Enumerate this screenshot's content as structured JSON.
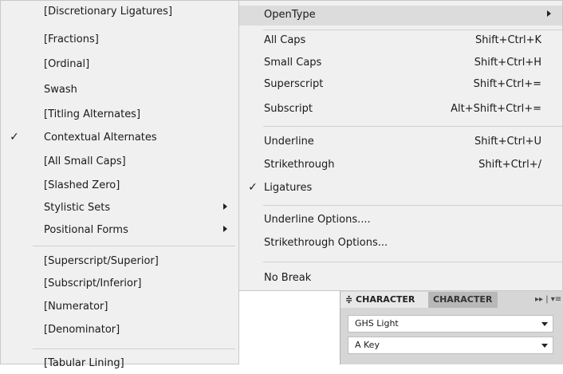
{
  "left_menu": {
    "items": [
      {
        "label": "[Discretionary Ligatures]",
        "checked": false,
        "submenu": false
      },
      {
        "label": "[Fractions]",
        "checked": false,
        "submenu": false
      },
      {
        "label": "[Ordinal]",
        "checked": false,
        "submenu": false
      },
      {
        "label": "Swash",
        "checked": false,
        "submenu": false
      },
      {
        "label": "[Titling Alternates]",
        "checked": false,
        "submenu": false
      },
      {
        "label": "Contextual Alternates",
        "checked": true,
        "submenu": false
      },
      {
        "label": "[All Small Caps]",
        "checked": false,
        "submenu": false
      },
      {
        "label": "[Slashed Zero]",
        "checked": false,
        "submenu": false
      },
      {
        "label": "Stylistic Sets",
        "checked": false,
        "submenu": true
      },
      {
        "label": "Positional Forms",
        "checked": false,
        "submenu": true
      },
      {
        "label": "[Superscript/Superior]",
        "checked": false,
        "submenu": false
      },
      {
        "label": "[Subscript/Inferior]",
        "checked": false,
        "submenu": false
      },
      {
        "label": "[Numerator]",
        "checked": false,
        "submenu": false
      },
      {
        "label": "[Denominator]",
        "checked": false,
        "submenu": false
      },
      {
        "label": "[Tabular Lining]",
        "checked": false,
        "submenu": false
      }
    ]
  },
  "right_menu": {
    "items": [
      {
        "label": "OpenType",
        "shortcut": "",
        "checked": false,
        "submenu": true
      },
      {
        "label": "All Caps",
        "shortcut": "Shift+Ctrl+K",
        "checked": false,
        "submenu": false
      },
      {
        "label": "Small Caps",
        "shortcut": "Shift+Ctrl+H",
        "checked": false,
        "submenu": false
      },
      {
        "label": "Superscript",
        "shortcut": "Shift+Ctrl+=",
        "checked": false,
        "submenu": false
      },
      {
        "label": "Subscript",
        "shortcut": "Alt+Shift+Ctrl+=",
        "checked": false,
        "submenu": false
      },
      {
        "label": "Underline",
        "shortcut": "Shift+Ctrl+U",
        "checked": false,
        "submenu": false
      },
      {
        "label": "Strikethrough",
        "shortcut": "Shift+Ctrl+/",
        "checked": false,
        "submenu": false
      },
      {
        "label": "Ligatures",
        "shortcut": "",
        "checked": true,
        "submenu": false
      },
      {
        "label": "Underline Options....",
        "shortcut": "",
        "checked": false,
        "submenu": false
      },
      {
        "label": "Strikethrough Options...",
        "shortcut": "",
        "checked": false,
        "submenu": false
      },
      {
        "label": "No Break",
        "shortcut": "",
        "checked": false,
        "submenu": false
      }
    ]
  },
  "check_glyph": "✓",
  "character_panel": {
    "tab_active": "≑ CHARACTER",
    "tab_inactive": "CHARACTER",
    "controls": "▸▸ | ▾≡",
    "font_family": "GHS Light",
    "font_style": "A Key"
  }
}
